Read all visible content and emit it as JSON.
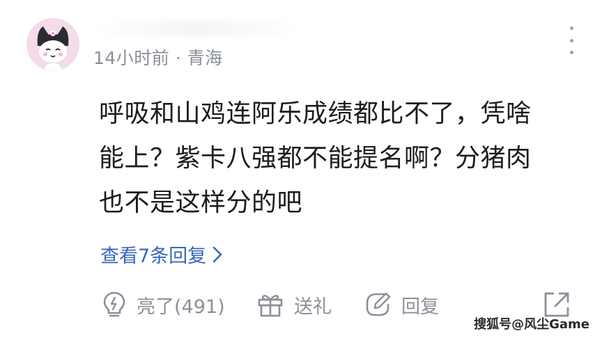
{
  "comment": {
    "meta": "14小时前 · 青海",
    "lines": [
      "呼吸和山鸡连阿乐成绩都比不了，凭啥",
      "能上？紫卡八强都不能提名啊？分猪肉",
      "也不是这样分的吧"
    ],
    "replies_label": "查看7条回复",
    "avatar_icon": "cartoon-avatar-icon"
  },
  "actions": {
    "like_label": "亮了(491)",
    "gift_label": "送礼",
    "reply_label": "回复"
  },
  "watermark": "搜狐号@风尘Game",
  "colors": {
    "link": "#3567b8",
    "meta": "#8a8f99",
    "text": "#1c1c1c",
    "avatar_bg": "#f4dcea"
  }
}
